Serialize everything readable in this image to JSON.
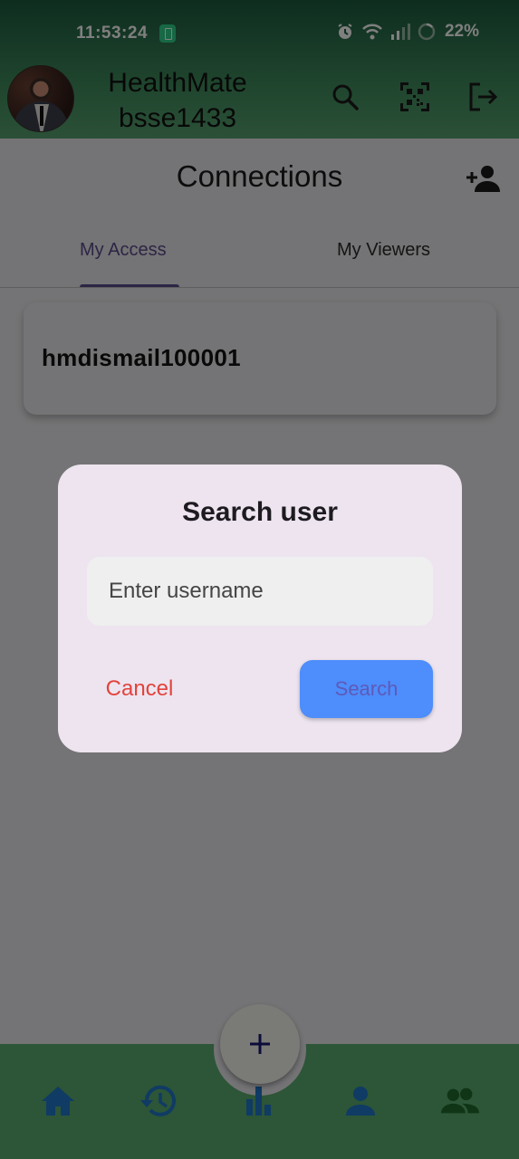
{
  "status_bar": {
    "time": "11:53:24",
    "battery": "22%"
  },
  "header": {
    "app_name": "HealthMate",
    "username": "bsse1433"
  },
  "page": {
    "title": "Connections",
    "tabs": [
      {
        "label": "My Access",
        "active": true
      },
      {
        "label": "My Viewers",
        "active": false
      }
    ]
  },
  "connections": [
    {
      "username": "hmdismail100001"
    }
  ],
  "dialog": {
    "title": "Search user",
    "input_placeholder": "Enter username",
    "input_value": "",
    "cancel_label": "Cancel",
    "search_label": "Search"
  },
  "icons": {
    "header": [
      "search-icon",
      "qr-code-icon",
      "logout-icon"
    ],
    "add": "person-add-icon",
    "nav": [
      "home-icon",
      "history-icon",
      "bar-chart-icon",
      "person-icon",
      "group-icon"
    ],
    "fab": "plus-icon"
  },
  "colors": {
    "header_green": "#3f8a5c",
    "nav_green": "#5aaa6e",
    "nav_icon_blue": "#1e77c8",
    "nav_active_green": "#1f6b2c",
    "accent_purple": "#5a4a8a",
    "cancel_red": "#e2433b",
    "search_blue": "#4d8dfc"
  }
}
